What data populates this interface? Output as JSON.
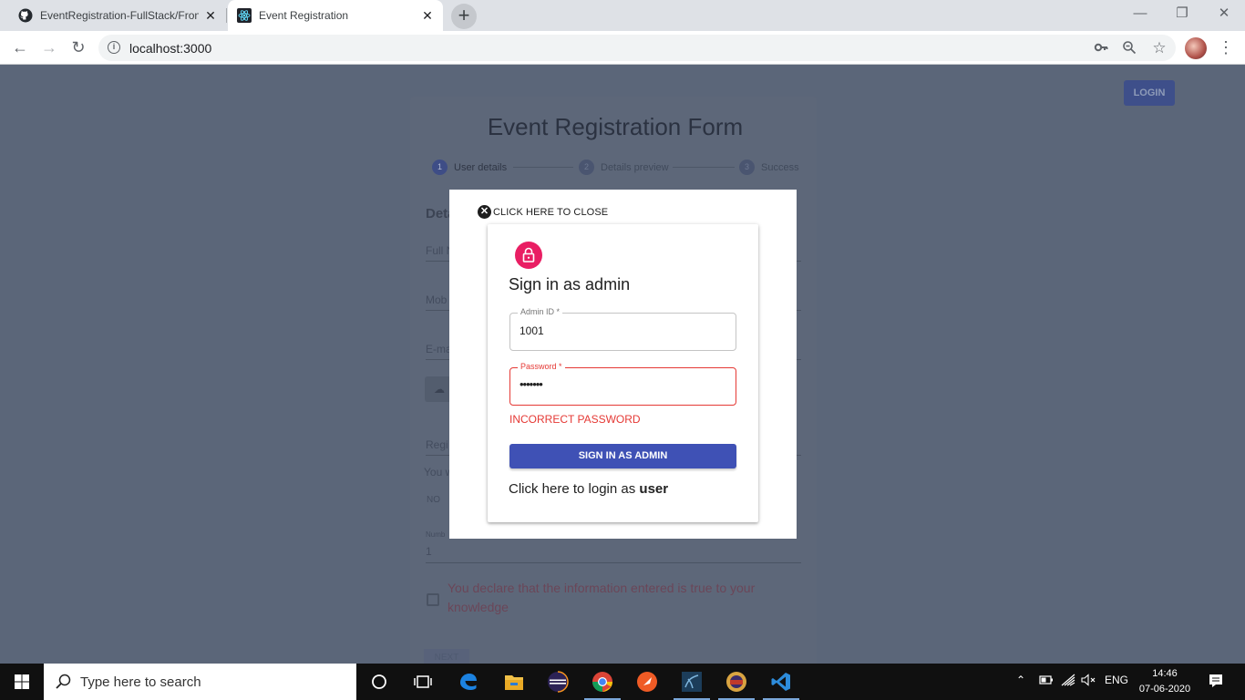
{
  "browser": {
    "tabs": [
      {
        "title": "EventRegistration-FullStack/Front",
        "icon": "github-icon",
        "active": false
      },
      {
        "title": "Event Registration",
        "icon": "react-icon",
        "active": true
      }
    ],
    "url": "localhost:3000"
  },
  "page": {
    "login_label": "LOGIN",
    "form_title": "Event Registration Form",
    "steps": [
      {
        "num": "1",
        "label": "User details"
      },
      {
        "num": "2",
        "label": "Details preview"
      },
      {
        "num": "3",
        "label": "Success"
      }
    ],
    "bg_heading": "Deta",
    "bg_full_name": "Full N",
    "bg_mobile": "Mob",
    "bg_email": "E-ma",
    "bg_reg": "Regi",
    "bg_you": "You w",
    "bg_no": "NO",
    "bg_number_label": "Numb",
    "bg_number_value": "1",
    "declaration": "You declare that the information entered is true to your knowledge",
    "next_label": "NEXT"
  },
  "modal": {
    "close_label": "CLICK HERE TO CLOSE",
    "title": "Sign in as admin",
    "admin_id_label": "Admin ID *",
    "admin_id_value": "1001",
    "password_label": "Password *",
    "password_value": "•••••••",
    "error": "INCORRECT PASSWORD",
    "signin_button": "SIGN IN AS ADMIN",
    "user_link_prefix": "Click here to login as ",
    "user_link_bold": "user"
  },
  "taskbar": {
    "search_placeholder": "Type here to search",
    "language": "ENG",
    "time": "14:46",
    "date": "07-06-2020"
  },
  "colors": {
    "accent": "#3f51b5",
    "error": "#e53935",
    "avatar": "#e91e63"
  }
}
